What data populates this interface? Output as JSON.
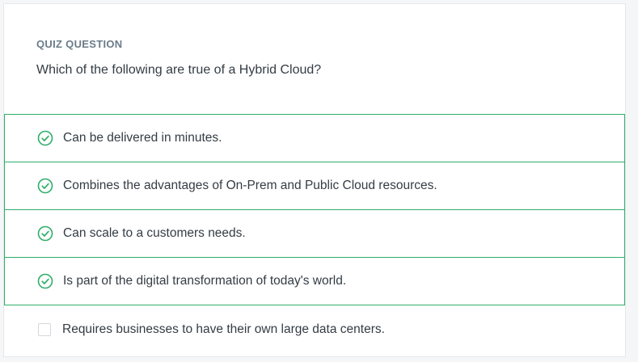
{
  "quiz": {
    "label": "QUIZ QUESTION",
    "question": "Which of the following are true of a Hybrid Cloud?",
    "answers": [
      {
        "text": "Can be delivered in minutes.",
        "selected": true
      },
      {
        "text": "Combines the advantages of On-Prem and Public Cloud resources.",
        "selected": true
      },
      {
        "text": "Can scale to a customers needs.",
        "selected": true
      },
      {
        "text": "Is part of the digital transformation of today's world.",
        "selected": true
      },
      {
        "text": "Requires businesses to have their own large data centers.",
        "selected": false
      }
    ]
  },
  "colors": {
    "correct": "#2fae6a",
    "text": "#333c44",
    "label": "#6b7c8a"
  }
}
